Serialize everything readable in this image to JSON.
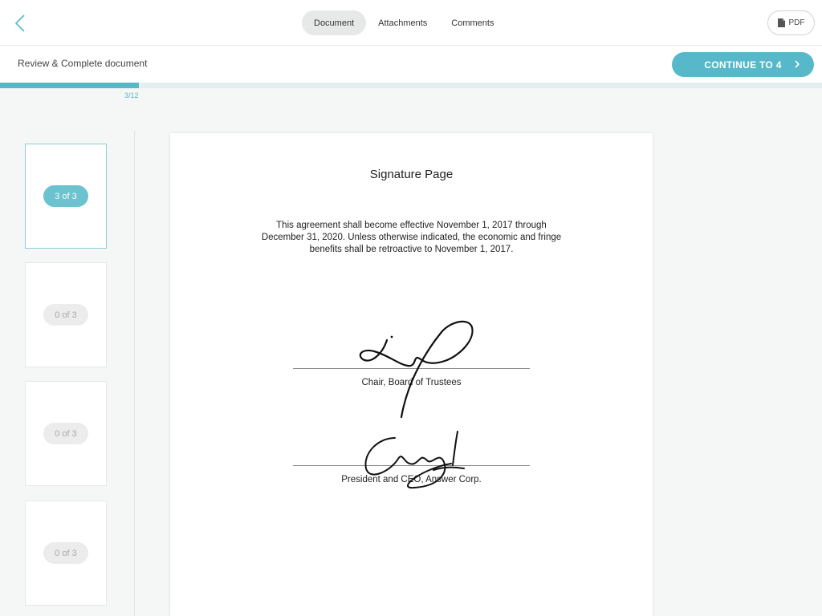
{
  "header": {
    "tabs": [
      {
        "label": "Document",
        "active": true
      },
      {
        "label": "Attachments",
        "active": false
      },
      {
        "label": "Comments",
        "active": false
      }
    ],
    "pdf_label": "PDF"
  },
  "review": {
    "title": "Review & Complete document",
    "continue_label": "CONTINUE TO 4"
  },
  "progress": {
    "label": "3/12",
    "fraction": 0.25
  },
  "thumbnails": [
    {
      "badge": "3 of 3",
      "active": true
    },
    {
      "badge": "0 of 3",
      "active": false
    },
    {
      "badge": "0 of 3",
      "active": false
    },
    {
      "badge": "0 of 3",
      "active": false
    }
  ],
  "document": {
    "title": "Signature Page",
    "body_lines": [
      "This agreement shall become effective November 1, 2017 through",
      "December 31, 2020. Unless otherwise indicated, the economic and fringe",
      "benefits shall be retroactive to November 1, 2017."
    ],
    "signatures": [
      {
        "caption": "Chair, Board of Trustees"
      },
      {
        "caption": "President and CEO, Answer Corp."
      }
    ]
  },
  "colors": {
    "accent": "#56b8c8",
    "accent_light": "#6cc2cf"
  }
}
